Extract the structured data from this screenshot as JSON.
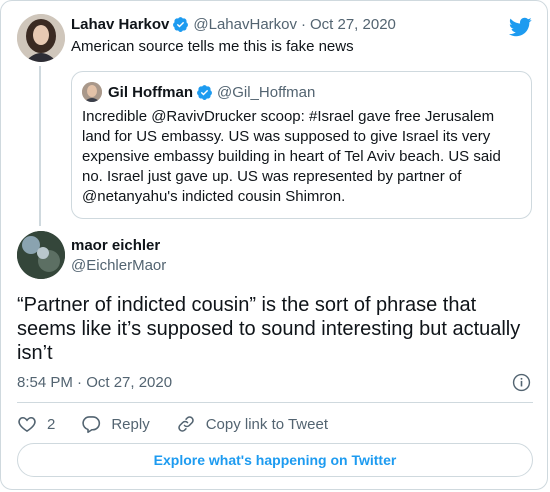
{
  "parent_tweet": {
    "author_name": "Lahav Harkov",
    "author_handle": "@LahavHarkov",
    "separator": "·",
    "date": "Oct 27, 2020",
    "text": "American source tells me this is fake news"
  },
  "quoted_tweet": {
    "author_name": "Gil Hoffman",
    "author_handle": "@Gil_Hoffman",
    "text": "Incredible @RavivDrucker scoop: #Israel gave free Jerusalem land for US embassy. US was supposed to give Israel its very expensive embassy building in heart of Tel Aviv beach. US said no. Israel just gave up. US was represented by partner of @netanyahu's indicted cousin Shimron."
  },
  "main_tweet": {
    "author_name": "maor eichler",
    "author_handle": "@EichlerMaor",
    "text": "“Partner of indicted cousin” is the sort of phrase that seems like it’s supposed to sound interesting but actually isn’t",
    "timestamp": "8:54 PM · Oct 27, 2020"
  },
  "actions": {
    "like_count": "2",
    "reply_label": "Reply",
    "copy_link_label": "Copy link to Tweet"
  },
  "explore_label": "Explore what's happening on Twitter",
  "colors": {
    "accent": "#1d9bf0",
    "text": "#0f1419",
    "secondary": "#536471",
    "border": "#cfd9de"
  },
  "icons": [
    "verified-badge-icon",
    "twitter-bird-icon",
    "info-icon",
    "heart-icon",
    "reply-bubble-icon",
    "link-icon"
  ]
}
